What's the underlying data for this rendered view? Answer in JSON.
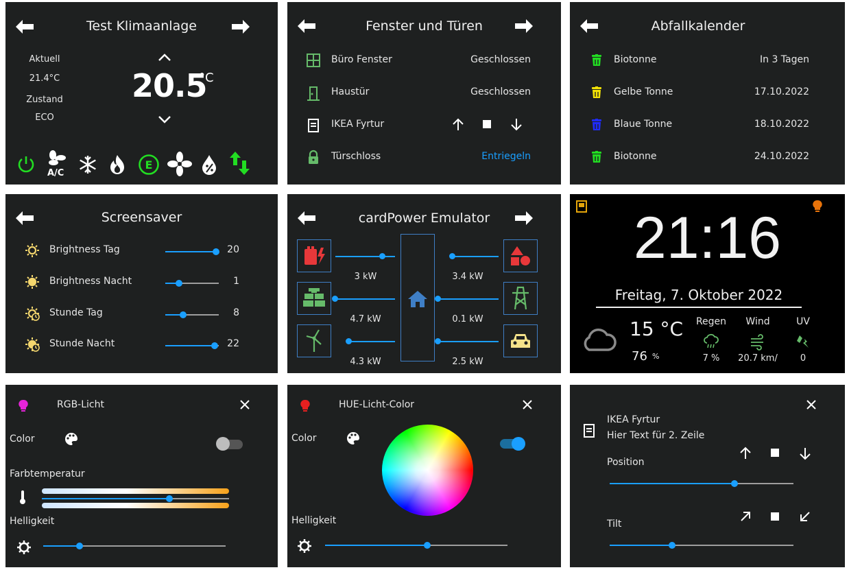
{
  "climate": {
    "title": "Test Klimaanlage",
    "current_label": "Aktuell",
    "current_temp": "21.4°C",
    "state_label": "Zustand",
    "state_value": "ECO",
    "setpoint": "20.5",
    "unit": "°C",
    "icons": [
      "power-icon",
      "ac-fan-icon",
      "snowflake-icon",
      "fire-icon",
      "eco-icon",
      "fan-icon",
      "dry-icon",
      "heat-cool-icon"
    ]
  },
  "entities": {
    "title": "Fenster und Türen",
    "rows": [
      {
        "name": "Büro Fenster",
        "value": "Geschlossen",
        "icon": "window-icon"
      },
      {
        "name": "Haustür",
        "value": "Geschlossen",
        "icon": "door-icon"
      },
      {
        "name": "IKEA Fyrtur",
        "value": "",
        "icon": "blind-icon"
      },
      {
        "name": "Türschloss",
        "value": "Entriegeln",
        "icon": "lock-icon"
      }
    ]
  },
  "waste": {
    "title": "Abfallkalender",
    "rows": [
      {
        "name": "Biotonne",
        "value": "In 3 Tagen",
        "color": "#22dd22"
      },
      {
        "name": "Gelbe Tonne",
        "value": "17.10.2022",
        "color": "#f2e205"
      },
      {
        "name": "Blaue Tonne",
        "value": "18.10.2022",
        "color": "#1f2bff"
      },
      {
        "name": "Biotonne",
        "value": "24.10.2022",
        "color": "#22dd22"
      }
    ]
  },
  "screensaver": {
    "title": "Screensaver",
    "rows": [
      {
        "name": "Brightness Tag",
        "value": "20",
        "level": 0.95
      },
      {
        "name": "Brightness Nacht",
        "value": "1",
        "level": 0.25
      },
      {
        "name": "Stunde Tag",
        "value": "8",
        "level": 0.33
      },
      {
        "name": "Stunde Nacht",
        "value": "22",
        "level": 0.92
      }
    ]
  },
  "power": {
    "title": "cardPower Emulator",
    "left": [
      {
        "value": "3 kW",
        "icon": "battery-icon",
        "color": "#e8383a"
      },
      {
        "value": "4.7 kW",
        "icon": "solar-icon",
        "color": "#66bb6a"
      },
      {
        "value": "4.3 kW",
        "icon": "wind-icon",
        "color": "#66bb6a"
      }
    ],
    "right": [
      {
        "value": "3.4 kW",
        "icon": "shapes-icon",
        "color": "#e8383a"
      },
      {
        "value": "0.1 kW",
        "icon": "transmission-tower-icon",
        "color": "#66bb6a"
      },
      {
        "value": "2.5 kW",
        "icon": "car-icon",
        "color": "#f4e28a"
      }
    ]
  },
  "clock": {
    "time": "21:16",
    "date": "Freitag, 7. Oktober 2022",
    "temp": "15 °C",
    "humidity": "76",
    "humidity_unit": "%",
    "regen_label": "Regen",
    "regen_value": "7 %",
    "wind_label": "Wind",
    "wind_value": "20.7 km/",
    "uv_label": "UV",
    "uv_value": "0"
  },
  "rgb": {
    "title": "RGB-Licht",
    "color_label": "Color",
    "ct_label": "Farbtemperatur",
    "brightness_label": "Helligkeit",
    "ct_level": 0.68,
    "brightness_level": 0.2
  },
  "hue": {
    "title": "HUE-Licht-Color",
    "color_label": "Color",
    "brightness_label": "Helligkeit",
    "brightness_level": 0.56
  },
  "cover": {
    "name": "IKEA Fyrtur",
    "line2": "Hier Text für 2. Zeile",
    "position_label": "Position",
    "tilt_label": "Tilt",
    "position_level": 0.68,
    "tilt_level": 0.34
  }
}
